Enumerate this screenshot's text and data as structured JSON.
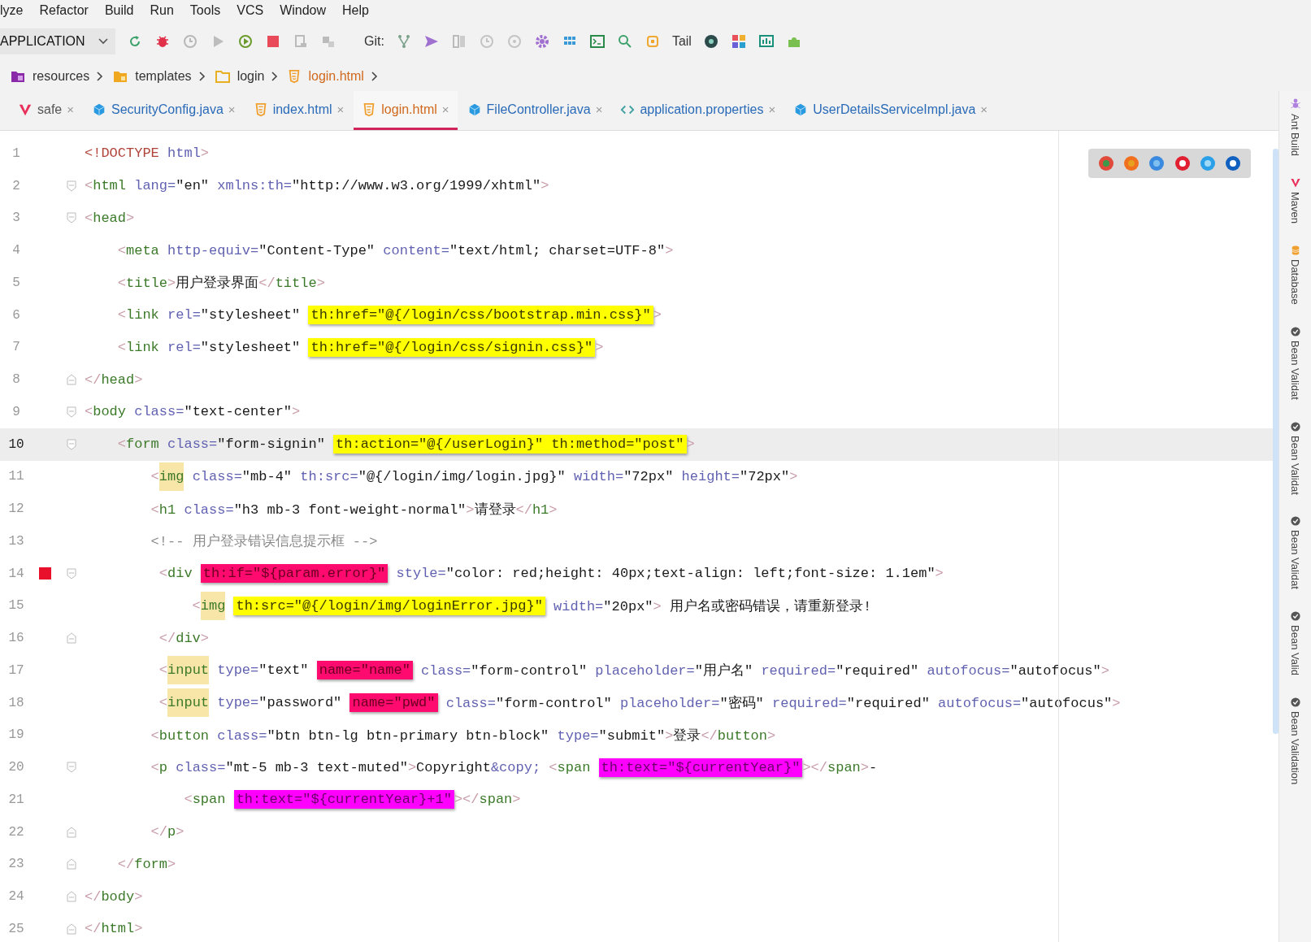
{
  "menu": [
    {
      "label": "lyze"
    },
    {
      "label": "Refactor"
    },
    {
      "label": "Build"
    },
    {
      "label": "Run"
    },
    {
      "label": "Tools"
    },
    {
      "label": "VCS"
    },
    {
      "label": "Window"
    },
    {
      "label": "Help"
    }
  ],
  "toolbar": {
    "run_config": "APPLICATION",
    "git_label": "Git:",
    "tail_label": "Tail"
  },
  "breadcrumb": [
    {
      "label": "resources",
      "kind": "resources-folder",
      "color": "#333333"
    },
    {
      "label": "templates",
      "kind": "templates-folder",
      "color": "#333333"
    },
    {
      "label": "login",
      "kind": "folder",
      "color": "#333333"
    },
    {
      "label": "login.html",
      "kind": "html",
      "color": "#d0691e"
    }
  ],
  "tabs": [
    {
      "label": "safe",
      "kind": "v",
      "selected": false,
      "color": "#555555",
      "close": "×"
    },
    {
      "label": "SecurityConfig.java",
      "kind": "java",
      "selected": false,
      "color": "#2a6bb8",
      "close": "×"
    },
    {
      "label": "index.html",
      "kind": "html",
      "selected": false,
      "color": "#2a6bb8",
      "close": "×"
    },
    {
      "label": "login.html",
      "kind": "html",
      "selected": true,
      "color": "#d0691e",
      "close": "×"
    },
    {
      "label": "FileController.java",
      "kind": "java",
      "selected": false,
      "color": "#2a6bb8",
      "close": "×"
    },
    {
      "label": "application.properties",
      "kind": "properties",
      "selected": false,
      "color": "#2a6bb8",
      "close": "×"
    },
    {
      "label": "UserDetailsServiceImpl.java",
      "kind": "java",
      "selected": false,
      "color": "#2a6bb8",
      "close": "×"
    }
  ],
  "lines": [
    {
      "number": "1",
      "current": false,
      "breakpoint": false,
      "fold_start": false,
      "fold_end": false,
      "tokens": [
        {
          "kind": "doctype",
          "text": "<!DOCTYPE"
        },
        {
          "kind": "attr",
          "text": " html"
        },
        {
          "kind": "bracket",
          "text": ">"
        }
      ]
    },
    {
      "number": "2",
      "current": false,
      "breakpoint": false,
      "fold_start": true,
      "fold_end": false,
      "tokens": [
        {
          "kind": "bracket",
          "text": "<"
        },
        {
          "kind": "tag",
          "text": "html"
        },
        {
          "kind": "attr",
          "text": " lang="
        },
        {
          "kind": "value",
          "text": "\"en\""
        },
        {
          "kind": "attr",
          "text": " xmlns:th="
        },
        {
          "kind": "value",
          "text": "\"http://www.w3.org/1999/xhtml\""
        },
        {
          "kind": "bracket",
          "text": ">"
        }
      ]
    },
    {
      "number": "3",
      "current": false,
      "breakpoint": false,
      "fold_start": true,
      "fold_end": false,
      "tokens": [
        {
          "kind": "bracket",
          "text": "<"
        },
        {
          "kind": "tag",
          "text": "head"
        },
        {
          "kind": "bracket",
          "text": ">"
        }
      ]
    },
    {
      "number": "4",
      "current": false,
      "breakpoint": false,
      "fold_start": false,
      "fold_end": false,
      "tokens": [
        {
          "kind": "bracket",
          "text": "    <"
        },
        {
          "kind": "tag",
          "text": "meta"
        },
        {
          "kind": "attr",
          "text": " http-equiv="
        },
        {
          "kind": "value",
          "text": "\"Content-Type\""
        },
        {
          "kind": "attr",
          "text": " content="
        },
        {
          "kind": "value",
          "text": "\"text/html; charset=UTF-8\""
        },
        {
          "kind": "bracket",
          "text": ">"
        }
      ]
    },
    {
      "number": "5",
      "current": false,
      "breakpoint": false,
      "fold_start": false,
      "fold_end": false,
      "tokens": [
        {
          "kind": "bracket",
          "text": "    <"
        },
        {
          "kind": "tag",
          "text": "title"
        },
        {
          "kind": "bracket",
          "text": ">"
        },
        {
          "kind": "text",
          "text": "用户登录界面"
        },
        {
          "kind": "bracket",
          "text": "</"
        },
        {
          "kind": "tag",
          "text": "title"
        },
        {
          "kind": "bracket",
          "text": ">"
        }
      ]
    },
    {
      "number": "6",
      "current": false,
      "breakpoint": false,
      "fold_start": false,
      "fold_end": false,
      "tokens": [
        {
          "kind": "bracket",
          "text": "    <"
        },
        {
          "kind": "tag",
          "text": "link"
        },
        {
          "kind": "attr",
          "text": " rel="
        },
        {
          "kind": "value",
          "text": "\"stylesheet\" "
        },
        {
          "kind": "mark-yellow",
          "text": "th:href=\"@{/login/css/bootstrap.min.css}\""
        },
        {
          "kind": "bracket",
          "text": ">"
        }
      ]
    },
    {
      "number": "7",
      "current": false,
      "breakpoint": false,
      "fold_start": false,
      "fold_end": false,
      "tokens": [
        {
          "kind": "bracket",
          "text": "    <"
        },
        {
          "kind": "tag",
          "text": "link"
        },
        {
          "kind": "attr",
          "text": " rel="
        },
        {
          "kind": "value",
          "text": "\"stylesheet\" "
        },
        {
          "kind": "mark-yellow",
          "text": "th:href=\"@{/login/css/signin.css}\""
        },
        {
          "kind": "bracket",
          "text": ">"
        }
      ]
    },
    {
      "number": "8",
      "current": false,
      "breakpoint": false,
      "fold_start": false,
      "fold_end": true,
      "tokens": [
        {
          "kind": "bracket",
          "text": "</"
        },
        {
          "kind": "tag",
          "text": "head"
        },
        {
          "kind": "bracket",
          "text": ">"
        }
      ]
    },
    {
      "number": "9",
      "current": false,
      "breakpoint": false,
      "fold_start": true,
      "fold_end": false,
      "tokens": [
        {
          "kind": "bracket",
          "text": "<"
        },
        {
          "kind": "tag",
          "text": "body"
        },
        {
          "kind": "attr",
          "text": " class="
        },
        {
          "kind": "value",
          "text": "\"text-center\""
        },
        {
          "kind": "bracket",
          "text": ">"
        }
      ]
    },
    {
      "number": "10",
      "current": true,
      "breakpoint": false,
      "fold_start": true,
      "fold_end": false,
      "tokens": [
        {
          "kind": "bracket",
          "text": "    <"
        },
        {
          "kind": "tag",
          "text": "form"
        },
        {
          "kind": "attr",
          "text": " class="
        },
        {
          "kind": "value",
          "text": "\"form-signin\" "
        },
        {
          "kind": "mark-yellow",
          "text": "th:action=\"@{/userLogin}\" th:method=\"post\""
        },
        {
          "kind": "bracket",
          "text": ">"
        }
      ]
    },
    {
      "number": "11",
      "current": false,
      "breakpoint": false,
      "fold_start": false,
      "fold_end": false,
      "tokens": [
        {
          "kind": "bracket",
          "text": "        <"
        },
        {
          "kind": "tag-warn",
          "text": "img"
        },
        {
          "kind": "attr",
          "text": " class="
        },
        {
          "kind": "value",
          "text": "\"mb-4\""
        },
        {
          "kind": "attr",
          "text": " th:src="
        },
        {
          "kind": "value",
          "text": "\"@{/login/img/login.jpg}\""
        },
        {
          "kind": "attr",
          "text": " width="
        },
        {
          "kind": "value",
          "text": "\"72px\""
        },
        {
          "kind": "attr",
          "text": " height="
        },
        {
          "kind": "value",
          "text": "\"72px\""
        },
        {
          "kind": "bracket",
          "text": ">"
        }
      ]
    },
    {
      "number": "12",
      "current": false,
      "breakpoint": false,
      "fold_start": false,
      "fold_end": false,
      "tokens": [
        {
          "kind": "bracket",
          "text": "        <"
        },
        {
          "kind": "tag",
          "text": "h1"
        },
        {
          "kind": "attr",
          "text": " class="
        },
        {
          "kind": "value",
          "text": "\"h3 mb-3 font-weight-normal\""
        },
        {
          "kind": "bracket",
          "text": ">"
        },
        {
          "kind": "text",
          "text": "请登录"
        },
        {
          "kind": "bracket",
          "text": "</"
        },
        {
          "kind": "tag",
          "text": "h1"
        },
        {
          "kind": "bracket",
          "text": ">"
        }
      ]
    },
    {
      "number": "13",
      "current": false,
      "breakpoint": false,
      "fold_start": false,
      "fold_end": false,
      "tokens": [
        {
          "kind": "comment",
          "text": "        <!-- 用户登录错误信息提示框 -->"
        }
      ]
    },
    {
      "number": "14",
      "current": false,
      "breakpoint": true,
      "fold_start": true,
      "fold_end": false,
      "tokens": [
        {
          "kind": "bracket",
          "text": "         <"
        },
        {
          "kind": "tag",
          "text": "div "
        },
        {
          "kind": "mark-red",
          "text": "th:if=\"${param.error}\""
        },
        {
          "kind": "attr",
          "text": " style="
        },
        {
          "kind": "value",
          "text": "\"color: red;height: 40px;text-align: left;font-size: 1.1em\""
        },
        {
          "kind": "bracket",
          "text": ">"
        }
      ]
    },
    {
      "number": "15",
      "current": false,
      "breakpoint": false,
      "fold_start": false,
      "fold_end": false,
      "tokens": [
        {
          "kind": "bracket",
          "text": "             <"
        },
        {
          "kind": "tag-warn",
          "text": "img"
        },
        {
          "kind": "mark-yellow",
          "text": "th:src=\"@{/login/img/loginError.jpg}\""
        },
        {
          "kind": "attr",
          "text": " width="
        },
        {
          "kind": "value",
          "text": "\"20px\""
        },
        {
          "kind": "bracket",
          "text": ">"
        },
        {
          "kind": "text",
          "text": " 用户名或密码错误，请重新登录!"
        }
      ]
    },
    {
      "number": "16",
      "current": false,
      "breakpoint": false,
      "fold_start": false,
      "fold_end": true,
      "tokens": [
        {
          "kind": "bracket",
          "text": "         </"
        },
        {
          "kind": "tag",
          "text": "div"
        },
        {
          "kind": "bracket",
          "text": ">"
        }
      ]
    },
    {
      "number": "17",
      "current": false,
      "breakpoint": false,
      "fold_start": false,
      "fold_end": false,
      "tokens": [
        {
          "kind": "bracket",
          "text": "         <"
        },
        {
          "kind": "tag-warn",
          "text": "input"
        },
        {
          "kind": "attr",
          "text": " type="
        },
        {
          "kind": "value",
          "text": "\"text\" "
        },
        {
          "kind": "mark-red",
          "text": "name=\"name\""
        },
        {
          "kind": "attr",
          "text": " class="
        },
        {
          "kind": "value",
          "text": "\"form-control\""
        },
        {
          "kind": "attr",
          "text": " placeholder="
        },
        {
          "kind": "value",
          "text": "\"用户名\""
        },
        {
          "kind": "attr",
          "text": " required="
        },
        {
          "kind": "value",
          "text": "\"required\""
        },
        {
          "kind": "attr",
          "text": " autofocus="
        },
        {
          "kind": "value",
          "text": "\"autofocus\""
        },
        {
          "kind": "bracket",
          "text": ">"
        }
      ]
    },
    {
      "number": "18",
      "current": false,
      "breakpoint": false,
      "fold_start": false,
      "fold_end": false,
      "tokens": [
        {
          "kind": "bracket",
          "text": "         <"
        },
        {
          "kind": "tag-warn",
          "text": "input"
        },
        {
          "kind": "attr",
          "text": " type="
        },
        {
          "kind": "value",
          "text": "\"password\" "
        },
        {
          "kind": "mark-red",
          "text": "name=\"pwd\""
        },
        {
          "kind": "attr",
          "text": " class="
        },
        {
          "kind": "value",
          "text": "\"form-control\""
        },
        {
          "kind": "attr",
          "text": " placeholder="
        },
        {
          "kind": "value",
          "text": "\"密码\""
        },
        {
          "kind": "attr",
          "text": " required="
        },
        {
          "kind": "value",
          "text": "\"required\""
        },
        {
          "kind": "attr",
          "text": " autofocus="
        },
        {
          "kind": "value",
          "text": "\"autofocus\""
        },
        {
          "kind": "bracket",
          "text": ">"
        }
      ]
    },
    {
      "number": "19",
      "current": false,
      "breakpoint": false,
      "fold_start": false,
      "fold_end": false,
      "tokens": [
        {
          "kind": "bracket",
          "text": "        <"
        },
        {
          "kind": "tag",
          "text": "button"
        },
        {
          "kind": "attr",
          "text": " class="
        },
        {
          "kind": "value",
          "text": "\"btn btn-lg btn-primary btn-block\""
        },
        {
          "kind": "attr",
          "text": " type="
        },
        {
          "kind": "value",
          "text": "\"submit\""
        },
        {
          "kind": "bracket",
          "text": ">"
        },
        {
          "kind": "text",
          "text": "登录"
        },
        {
          "kind": "bracket",
          "text": "</"
        },
        {
          "kind": "tag",
          "text": "button"
        },
        {
          "kind": "bracket",
          "text": ">"
        }
      ]
    },
    {
      "number": "20",
      "current": false,
      "breakpoint": false,
      "fold_start": true,
      "fold_end": false,
      "tokens": [
        {
          "kind": "bracket",
          "text": "        <"
        },
        {
          "kind": "tag",
          "text": "p"
        },
        {
          "kind": "attr",
          "text": " class="
        },
        {
          "kind": "value",
          "text": "\"mt-5 mb-3 text-muted\""
        },
        {
          "kind": "bracket",
          "text": ">"
        },
        {
          "kind": "text",
          "text": "Copyright"
        },
        {
          "kind": "attr",
          "text": "&copy;"
        },
        {
          "kind": "bracket",
          "text": " <"
        },
        {
          "kind": "tag",
          "text": "span "
        },
        {
          "kind": "mark-magenta",
          "text": "th:text=\"${currentYear}\""
        },
        {
          "kind": "bracket",
          "text": "></"
        },
        {
          "kind": "tag",
          "text": "span"
        },
        {
          "kind": "bracket",
          "text": ">"
        },
        {
          "kind": "text",
          "text": "-"
        }
      ]
    },
    {
      "number": "21",
      "current": false,
      "breakpoint": false,
      "fold_start": false,
      "fold_end": false,
      "tokens": [
        {
          "kind": "bracket",
          "text": "            <"
        },
        {
          "kind": "tag",
          "text": "span "
        },
        {
          "kind": "mark-magenta",
          "text": "th:text=\"${currentYear}+1\""
        },
        {
          "kind": "bracket",
          "text": "></"
        },
        {
          "kind": "tag",
          "text": "span"
        },
        {
          "kind": "bracket",
          "text": ">"
        }
      ]
    },
    {
      "number": "22",
      "current": false,
      "breakpoint": false,
      "fold_start": false,
      "fold_end": true,
      "tokens": [
        {
          "kind": "bracket",
          "text": "        </"
        },
        {
          "kind": "tag",
          "text": "p"
        },
        {
          "kind": "bracket",
          "text": ">"
        }
      ]
    },
    {
      "number": "23",
      "current": false,
      "breakpoint": false,
      "fold_start": false,
      "fold_end": true,
      "tokens": [
        {
          "kind": "bracket",
          "text": "    </"
        },
        {
          "kind": "tag",
          "text": "form"
        },
        {
          "kind": "bracket",
          "text": ">"
        }
      ]
    },
    {
      "number": "24",
      "current": false,
      "breakpoint": false,
      "fold_start": false,
      "fold_end": true,
      "tokens": [
        {
          "kind": "bracket",
          "text": "</"
        },
        {
          "kind": "tag",
          "text": "body"
        },
        {
          "kind": "bracket",
          "text": ">"
        }
      ]
    },
    {
      "number": "25",
      "current": false,
      "breakpoint": false,
      "fold_start": false,
      "fold_end": true,
      "tokens": [
        {
          "kind": "bracket",
          "text": "</"
        },
        {
          "kind": "tag",
          "text": "html"
        },
        {
          "kind": "bracket",
          "text": ">"
        }
      ]
    }
  ],
  "tool_windows": [
    {
      "label": "Ant Build",
      "kind": "ant"
    },
    {
      "label": "Maven",
      "kind": "maven"
    },
    {
      "label": "Database",
      "kind": "database"
    },
    {
      "label": "Bean Validat",
      "kind": "bean"
    },
    {
      "label": "Bean Validat",
      "kind": "bean"
    },
    {
      "label": "Bean Validat",
      "kind": "bean"
    },
    {
      "label": "Bean Valid",
      "kind": "bean"
    },
    {
      "label": "Bean Validation",
      "kind": "bean"
    }
  ]
}
